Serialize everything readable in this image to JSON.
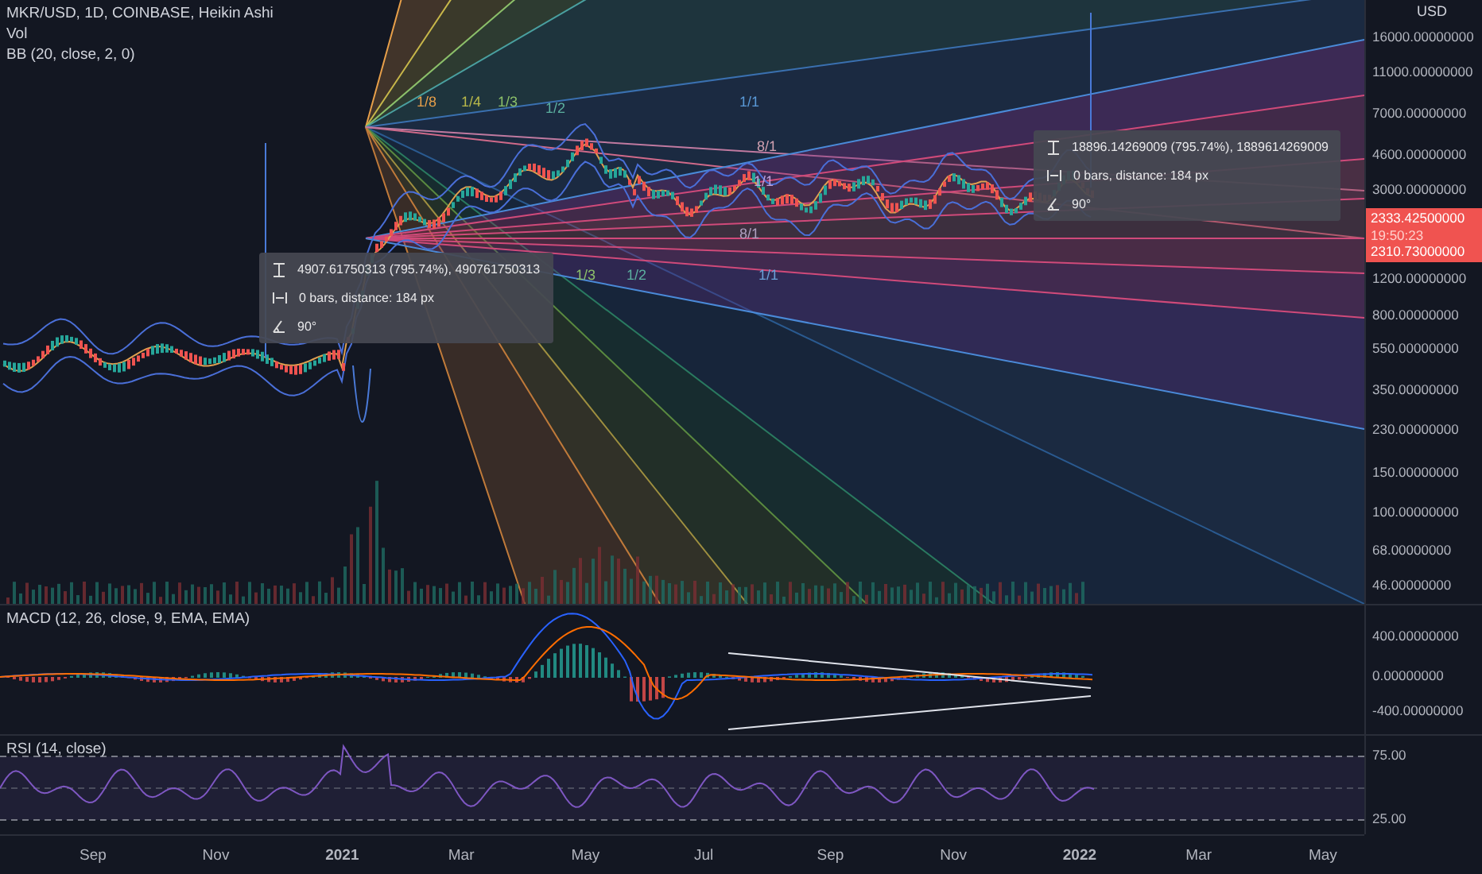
{
  "legends": [
    {
      "text": "MKR/USD, 1D, COINBASE, Heikin Ashi"
    },
    {
      "text": "Vol"
    },
    {
      "text": "BB (20, close, 2, 0)"
    }
  ],
  "fan_labels": [
    {
      "text": "1/8",
      "color": "#e8a04a"
    },
    {
      "text": "1/4",
      "color": "#b8b84a"
    },
    {
      "text": "1/3",
      "color": "#8cc06a"
    },
    {
      "text": "1/2",
      "color": "#5cb0a0"
    },
    {
      "text": "1/1",
      "color": "#5a9ad8"
    },
    {
      "text": "8/1",
      "color": "#d0a0b0"
    },
    {
      "text": "1/1",
      "color": "#c0a0d8"
    },
    {
      "text": "8/1",
      "color": "#b0a0c0"
    },
    {
      "text": "1/3",
      "color": "#8cc06a"
    },
    {
      "text": "1/2",
      "color": "#5cb0a0"
    },
    {
      "text": "1/1",
      "color": "#6aa0d8"
    }
  ],
  "measure_tooltips": [
    {
      "lines": [
        {
          "kind": "price_range",
          "text": "4907.61750313 (795.74%), 490761750313"
        },
        {
          "kind": "bars_range",
          "text": "0 bars, distance: 184 px"
        },
        {
          "kind": "angle",
          "text": "90°"
        }
      ]
    },
    {
      "lines": [
        {
          "kind": "price_range",
          "text": "18896.14269009 (795.74%), 1889614269009"
        },
        {
          "kind": "bars_range",
          "text": "0 bars, distance: 184 px"
        },
        {
          "kind": "angle",
          "text": "90°"
        }
      ]
    }
  ],
  "price_axis": {
    "currency": "USD",
    "ticks": [
      "16000.00000000",
      "11000.00000000",
      "7000.00000000",
      "4600.00000000",
      "3000.00000000",
      "1200.00000000",
      "800.00000000",
      "550.00000000",
      "350.00000000",
      "230.00000000",
      "150.00000000",
      "100.00000000",
      "68.00000000",
      "46.00000000"
    ],
    "last_price": {
      "price": "2333.42500000",
      "countdown": "19:50:23",
      "previous": "2310.73000000"
    }
  },
  "macd": {
    "legend": "MACD (12, 26, close, 9, EMA, EMA)",
    "ticks": [
      "400.00000000",
      "0.00000000",
      "-400.00000000"
    ]
  },
  "rsi": {
    "legend": "RSI (14, close)",
    "ticks": [
      "75.00",
      "25.00"
    ]
  },
  "time_axis": [
    {
      "label": "Sep",
      "kind": "month"
    },
    {
      "label": "Nov",
      "kind": "month"
    },
    {
      "label": "2021",
      "kind": "year"
    },
    {
      "label": "Mar",
      "kind": "month"
    },
    {
      "label": "May",
      "kind": "month"
    },
    {
      "label": "Jul",
      "kind": "month"
    },
    {
      "label": "Sep",
      "kind": "month"
    },
    {
      "label": "Nov",
      "kind": "month"
    },
    {
      "label": "2022",
      "kind": "year"
    },
    {
      "label": "Mar",
      "kind": "month"
    },
    {
      "label": "May",
      "kind": "month"
    }
  ]
}
